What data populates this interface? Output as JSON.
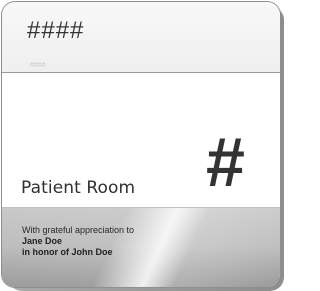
{
  "sign": {
    "top_code": "####",
    "tiny_code": "####",
    "room_label": "Patient Room",
    "room_number": "#",
    "donor": {
      "line1": "With grateful appreciation to",
      "line2": "Jane Doe",
      "line3": "in honor of John Doe"
    }
  },
  "colors": {
    "text_dark": "#333333",
    "panel_light": "#f3f3f3",
    "silver_panel": "#bdbdbd",
    "border_gray": "#9a9a9a"
  }
}
